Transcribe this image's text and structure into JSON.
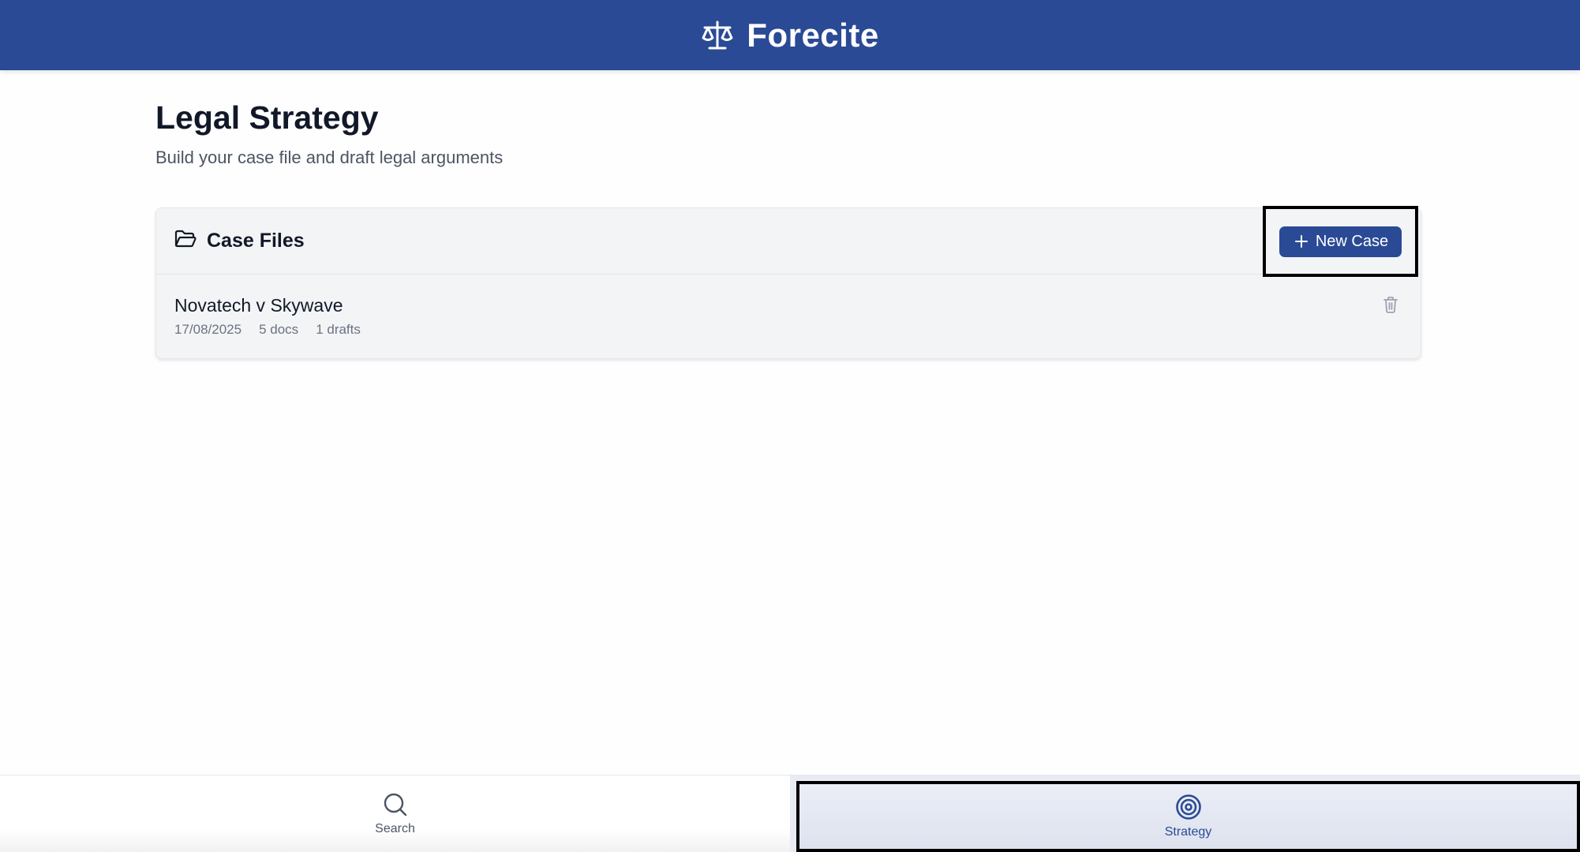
{
  "header": {
    "app_name": "Forecite",
    "logo_icon": "scale-icon",
    "brand_color": "#2a4a95"
  },
  "page": {
    "title": "Legal Strategy",
    "subtitle": "Build your case file and draft legal arguments"
  },
  "case_files": {
    "title": "Case Files",
    "title_icon": "folder-open-icon",
    "new_case_label": "New Case",
    "new_case_icon": "plus-icon",
    "items": [
      {
        "name": "Novatech v Skywave",
        "date": "17/08/2025",
        "docs": "5 docs",
        "drafts": "1 drafts",
        "delete_icon": "trash-icon"
      }
    ]
  },
  "bottom_nav": {
    "items": [
      {
        "label": "Search",
        "icon": "search-icon",
        "active": false
      },
      {
        "label": "Strategy",
        "icon": "target-icon",
        "active": true
      }
    ]
  }
}
